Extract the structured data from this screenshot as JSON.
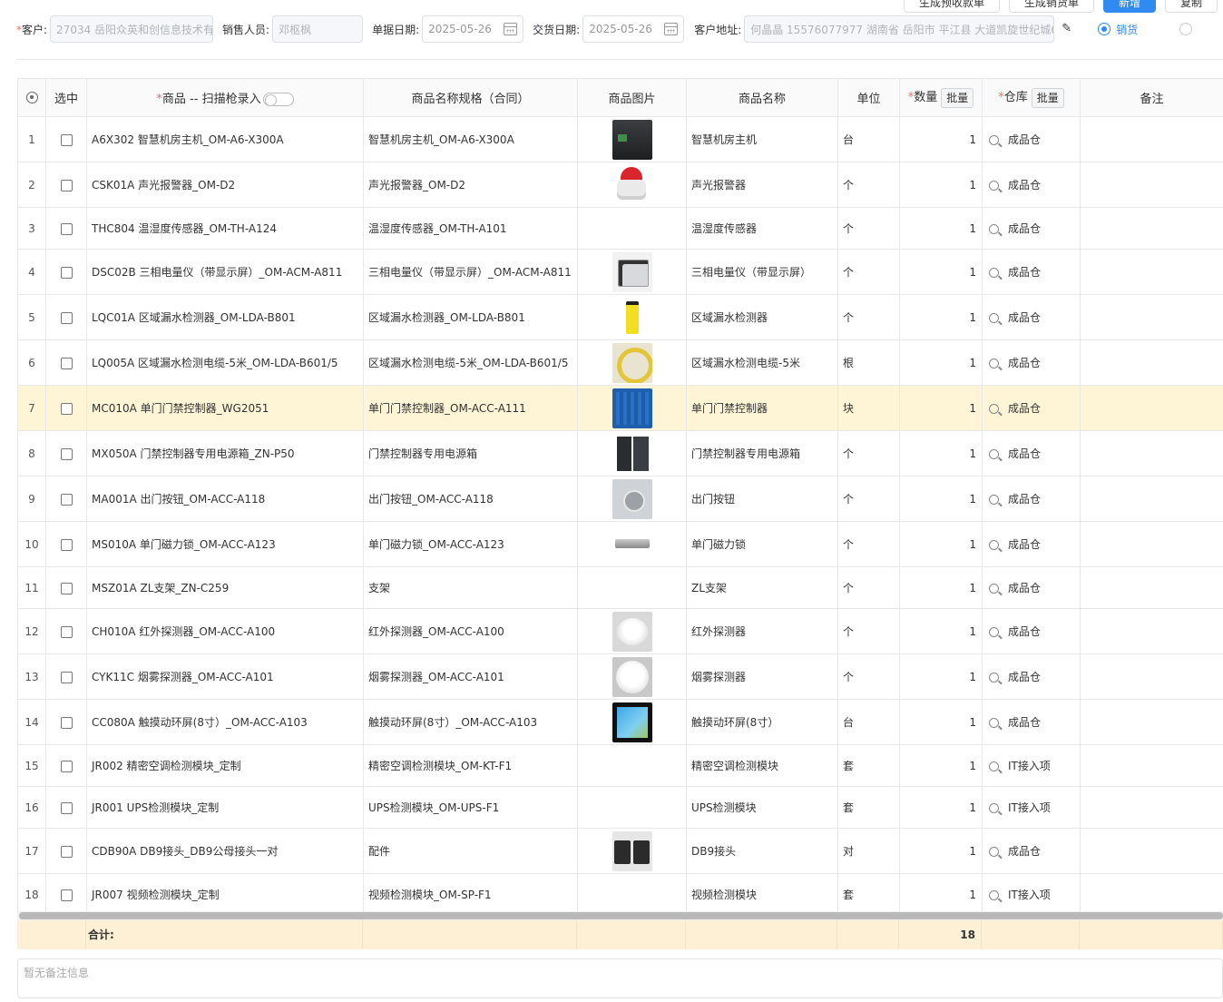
{
  "toolbar": {
    "btn_receipt": "生成预收款单",
    "btn_sales": "生成销货单",
    "btn_new": "新增",
    "btn_more": "复制"
  },
  "header": {
    "customer_label": "客户:",
    "customer_value": "27034 岳阳众英和创信息技术有",
    "sales_label": "销售人员:",
    "sales_value": "邓枢枫",
    "doc_date_label": "单据日期:",
    "doc_date_value": "2025-05-26",
    "delivery_date_label": "交货日期:",
    "delivery_date_value": "2025-05-26",
    "address_label": "客户地址:",
    "address_value": "何晶晶 15576077977 湖南省 岳阳市 平江县 大道凯旋世纪城6",
    "type_selected": "销货"
  },
  "table": {
    "headers": {
      "select": "选中",
      "product": "商品 -- 扫描枪录入",
      "spec": "商品名称规格（合同）",
      "image": "商品图片",
      "name": "商品名称",
      "unit": "单位",
      "qty": "数量",
      "warehouse": "仓库",
      "note": "备注",
      "bulk": "批量"
    },
    "rows": [
      {
        "idx": "1",
        "product": "A6X302 智慧机房主机_OM-A6-X300A",
        "spec": "智慧机房主机_OM-A6-X300A",
        "img": "server-host",
        "name": "智慧机房主机",
        "unit": "台",
        "qty": "1",
        "wh": "成品仓"
      },
      {
        "idx": "2",
        "product": "CSK01A 声光报警器_OM-D2",
        "spec": "声光报警器_OM-D2",
        "img": "alarm",
        "name": "声光报警器",
        "unit": "个",
        "qty": "1",
        "wh": "成品仓"
      },
      {
        "idx": "3",
        "product": "THC804 温湿度传感器_OM-TH-A124",
        "spec": "温湿度传感器_OM-TH-A101",
        "img": "",
        "name": "温湿度传感器",
        "unit": "个",
        "qty": "1",
        "wh": "成品仓"
      },
      {
        "idx": "4",
        "product": "DSC02B 三相电量仪（带显示屏）_OM-ACM-A811",
        "spec": "三相电量仪（带显示屏）_OM-ACM-A811",
        "img": "meter",
        "name": "三相电量仪（带显示屏）",
        "unit": "个",
        "qty": "1",
        "wh": "成品仓"
      },
      {
        "idx": "5",
        "product": "LQC01A 区域漏水检测器_OM-LDA-B801",
        "spec": "区域漏水检测器_OM-LDA-B801",
        "img": "leak",
        "name": "区域漏水检测器",
        "unit": "个",
        "qty": "1",
        "wh": "成品仓"
      },
      {
        "idx": "6",
        "product": "LQ005A 区域漏水检测电缆-5米_OM-LDA-B601/5",
        "spec": "区域漏水检测电缆-5米_OM-LDA-B601/5",
        "img": "cable",
        "name": "区域漏水检测电缆-5米",
        "unit": "根",
        "qty": "1",
        "wh": "成品仓"
      },
      {
        "idx": "7",
        "product": "MC010A 单门门禁控制器_WG2051",
        "spec": "单门门禁控制器_OM-ACC-A111",
        "img": "board",
        "name": "单门门禁控制器",
        "unit": "块",
        "qty": "1",
        "wh": "成品仓",
        "hl": true
      },
      {
        "idx": "8",
        "product": "MX050A 门禁控制器专用电源箱_ZN-P50",
        "spec": "门禁控制器专用电源箱",
        "img": "psu",
        "name": "门禁控制器专用电源箱",
        "unit": "个",
        "qty": "1",
        "wh": "成品仓"
      },
      {
        "idx": "9",
        "product": "MA001A 出门按钮_OM-ACC-A118",
        "spec": "出门按钮_OM-ACC-A118",
        "img": "button",
        "name": "出门按钮",
        "unit": "个",
        "qty": "1",
        "wh": "成品仓"
      },
      {
        "idx": "10",
        "product": "MS010A 单门磁力锁_OM-ACC-A123",
        "spec": "单门磁力锁_OM-ACC-A123",
        "img": "lock",
        "name": "单门磁力锁",
        "unit": "个",
        "qty": "1",
        "wh": "成品仓"
      },
      {
        "idx": "11",
        "product": "MSZ01A ZL支架_ZN-C259",
        "spec": "支架",
        "img": "",
        "name": "ZL支架",
        "unit": "个",
        "qty": "1",
        "wh": "成品仓"
      },
      {
        "idx": "12",
        "product": "CH010A 红外探测器_OM-ACC-A100",
        "spec": "红外探测器_OM-ACC-A100",
        "img": "pir",
        "name": "红外探测器",
        "unit": "个",
        "qty": "1",
        "wh": "成品仓"
      },
      {
        "idx": "13",
        "product": "CYK11C 烟雾探测器_OM-ACC-A101",
        "spec": "烟雾探测器_OM-ACC-A101",
        "img": "smoke",
        "name": "烟雾探测器",
        "unit": "个",
        "qty": "1",
        "wh": "成品仓"
      },
      {
        "idx": "14",
        "product": "CC080A 触摸动环屏(8寸）_OM-ACC-A103",
        "spec": "触摸动环屏(8寸）_OM-ACC-A103",
        "img": "screen",
        "name": "触摸动环屏(8寸）",
        "unit": "台",
        "qty": "1",
        "wh": "成品仓"
      },
      {
        "idx": "15",
        "product": "JR002 精密空调检测模块_定制",
        "spec": "精密空调检测模块_OM-KT-F1",
        "img": "",
        "name": "精密空调检测模块",
        "unit": "套",
        "qty": "1",
        "wh": "IT接入项"
      },
      {
        "idx": "16",
        "product": "JR001 UPS检测模块_定制",
        "spec": "UPS检测模块_OM-UPS-F1",
        "img": "",
        "name": "UPS检测模块",
        "unit": "套",
        "qty": "1",
        "wh": "IT接入项"
      },
      {
        "idx": "17",
        "product": "CDB90A DB9接头_DB9公母接头一对",
        "spec": "配件",
        "img": "db9",
        "name": "DB9接头",
        "unit": "对",
        "qty": "1",
        "wh": "成品仓"
      },
      {
        "idx": "18",
        "product": "JR007 视频检测模块_定制",
        "spec": "视频检测模块_OM-SP-F1",
        "img": "",
        "name": "视频检测模块",
        "unit": "套",
        "qty": "1",
        "wh": "IT接入项"
      }
    ]
  },
  "totals": {
    "label": "合计:",
    "qty": "18"
  },
  "remark": {
    "placeholder": "暂无备注信息"
  }
}
